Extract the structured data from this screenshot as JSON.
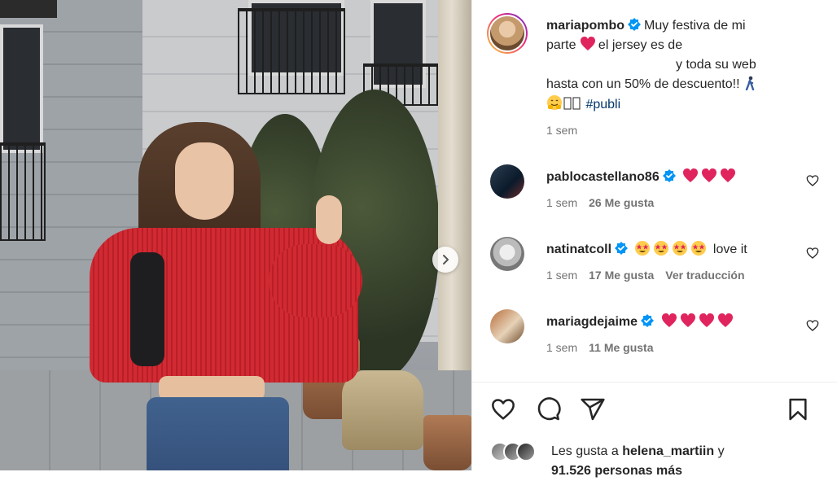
{
  "post": {
    "author": "mariapombo",
    "caption_lines": [
      "Muy festiva de mi",
      "parte",
      "el jersey es de",
      "y toda su web",
      "hasta con un 50% de descuento!!",
      "#publi"
    ],
    "time": "1 sem"
  },
  "comments": [
    {
      "user": "pablocastellano86",
      "verified": true,
      "text": "",
      "emoji": "heart",
      "emoji_count": 3,
      "time": "1 sem",
      "likes": "26 Me gusta",
      "translate": ""
    },
    {
      "user": "natinatcoll",
      "verified": true,
      "text": "love it",
      "emoji": "star-eyes",
      "emoji_count": 4,
      "time": "1 sem",
      "likes": "17 Me gusta",
      "translate": "Ver traducción"
    },
    {
      "user": "mariagdejaime",
      "verified": true,
      "text": "",
      "emoji": "heart",
      "emoji_count": 4,
      "time": "1 sem",
      "likes": "11 Me gusta",
      "translate": ""
    }
  ],
  "likes": {
    "prefix": "Les gusta a",
    "user": "helena_martiin",
    "suffix": "y",
    "more": "91.526 personas más"
  },
  "icons": {
    "verified": "verified-badge-icon",
    "like": "heart-outline-icon",
    "comment": "comment-bubble-icon",
    "share": "paper-plane-icon",
    "save": "bookmark-icon",
    "next": "chevron-right-icon"
  },
  "colors": {
    "verified": "#0095f6",
    "heart_emoji": "#e0245e",
    "hashtag": "#00376b",
    "muted": "#737373"
  }
}
